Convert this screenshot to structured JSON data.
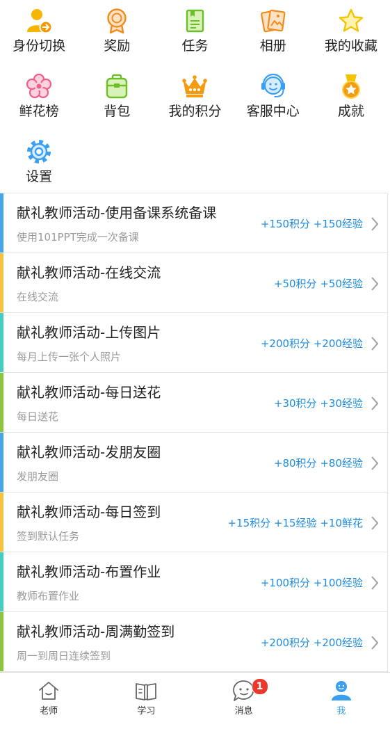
{
  "grid": {
    "items": [
      {
        "label": "身份切换",
        "icon": "user-switch-icon"
      },
      {
        "label": "奖励",
        "icon": "award-medal-icon"
      },
      {
        "label": "任务",
        "icon": "task-document-icon"
      },
      {
        "label": "相册",
        "icon": "photo-album-icon"
      },
      {
        "label": "我的收藏",
        "icon": "star-icon"
      },
      {
        "label": "鲜花榜",
        "icon": "flower-icon"
      },
      {
        "label": "背包",
        "icon": "backpack-icon"
      },
      {
        "label": "我的积分",
        "icon": "crown-icon"
      },
      {
        "label": "客服中心",
        "icon": "customer-service-icon"
      },
      {
        "label": "成就",
        "icon": "achievement-medal-icon"
      },
      {
        "label": "设置",
        "icon": "gear-icon"
      }
    ]
  },
  "tasks": [
    {
      "title": "献礼教师活动-使用备课系统备课",
      "subtitle": "使用101PPT完成一次备课",
      "reward": "+150积分 +150经验",
      "accent": "#45a6ea"
    },
    {
      "title": "献礼教师活动-在线交流",
      "subtitle": "在线交流",
      "reward": "+50积分 +50经验",
      "accent": "#f7c242"
    },
    {
      "title": "献礼教师活动-上传图片",
      "subtitle": "每月上传一张个人照片",
      "reward": "+200积分 +200经验",
      "accent": "#45cdc2"
    },
    {
      "title": "献礼教师活动-每日送花",
      "subtitle": "每日送花",
      "reward": "+30积分 +30经验",
      "accent": "#8cc63f"
    },
    {
      "title": "献礼教师活动-发朋友圈",
      "subtitle": "发朋友圈",
      "reward": "+80积分 +80经验",
      "accent": "#45a6ea"
    },
    {
      "title": "献礼教师活动-每日签到",
      "subtitle": "签到默认任务",
      "reward": "+15积分 +15经验 +10鲜花",
      "accent": "#f7c242"
    },
    {
      "title": "献礼教师活动-布置作业",
      "subtitle": "教师布置作业",
      "reward": "+100积分 +100经验",
      "accent": "#45cdc2"
    },
    {
      "title": "献礼教师活动-周满勤签到",
      "subtitle": "周一到周日连续签到",
      "reward": "+200积分 +200经验",
      "accent": "#8cc63f"
    }
  ],
  "tabbar": {
    "items": [
      {
        "label": "老师",
        "icon": "home-icon",
        "active": false
      },
      {
        "label": "学习",
        "icon": "book-icon",
        "active": false
      },
      {
        "label": "消息",
        "icon": "chat-icon",
        "active": false,
        "badge": "1"
      },
      {
        "label": "我",
        "icon": "person-icon",
        "active": true
      }
    ]
  },
  "colors": {
    "reward_text": "#1e8ce0",
    "active_tab": "#3a9ff0",
    "inactive_tab": "#333333",
    "badge": "#e8392b"
  }
}
